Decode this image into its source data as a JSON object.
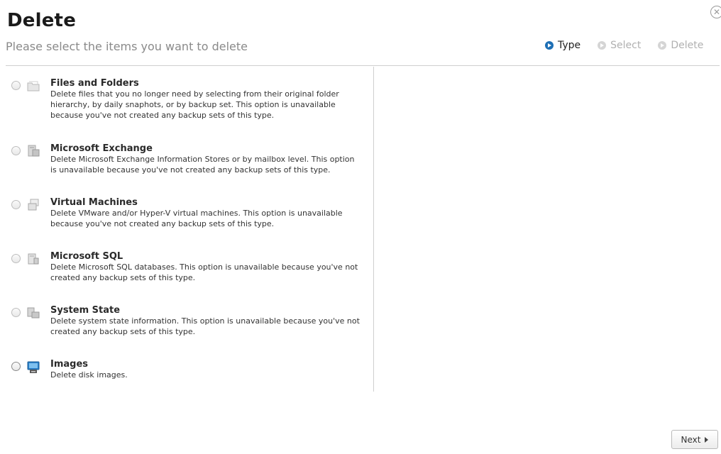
{
  "header": {
    "title": "Delete",
    "subtitle": "Please select the items you want to delete",
    "close_symbol": "✕"
  },
  "steps": [
    {
      "label": "Type",
      "active": true
    },
    {
      "label": "Select",
      "active": false
    },
    {
      "label": "Delete",
      "active": false
    }
  ],
  "options": [
    {
      "title": "Files and Folders",
      "description": "Delete files that you no longer need by selecting from their original folder hierarchy, by daily snaphots, or by backup set. This option is unavailable because you've not created any backup sets of this type.",
      "icon": "folder-icon"
    },
    {
      "title": "Microsoft Exchange",
      "description": "Delete Microsoft Exchange Information Stores or by mailbox level. This option is unavailable because you've not created any backup sets of this type.",
      "icon": "exchange-icon"
    },
    {
      "title": "Virtual Machines",
      "description": "Delete VMware and/or Hyper-V virtual machines. This option is unavailable because you've not created any backup sets of this type.",
      "icon": "virtual-machine-icon"
    },
    {
      "title": "Microsoft SQL",
      "description": "Delete Microsoft SQL databases. This option is unavailable because you've not created any backup sets of this type.",
      "icon": "database-icon"
    },
    {
      "title": "System State",
      "description": "Delete system state information. This option is unavailable because you've not created any backup sets of this type.",
      "icon": "system-state-icon"
    },
    {
      "title": "Images",
      "description": "Delete disk images.",
      "icon": "disk-image-icon"
    }
  ],
  "footer": {
    "next_label": "Next"
  },
  "colors": {
    "accent": "#1e6fb5",
    "inactive": "#b0b0b0",
    "subtitle": "#8a8a8a"
  }
}
